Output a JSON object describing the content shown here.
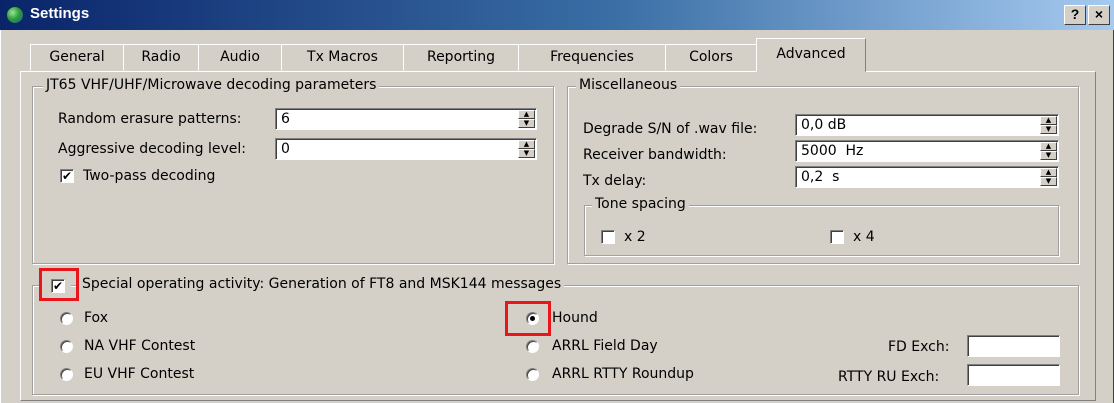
{
  "window": {
    "title": "Settings",
    "help_label": "?",
    "close_label": "×"
  },
  "tabs": [
    {
      "label": "General"
    },
    {
      "label": "Radio"
    },
    {
      "label": "Audio"
    },
    {
      "label": "Tx Macros"
    },
    {
      "label": "Reporting"
    },
    {
      "label": "Frequencies"
    },
    {
      "label": "Colors"
    },
    {
      "label": "Advanced"
    }
  ],
  "active_tab": "Advanced",
  "jt65": {
    "title": "JT65 VHF/UHF/Microwave decoding parameters",
    "random_erasure_label": "Random erasure patterns:",
    "random_erasure_value": "6",
    "aggressive_label": "Aggressive decoding level:",
    "aggressive_value": "0",
    "two_pass_label": "Two-pass decoding",
    "two_pass_checked": true
  },
  "misc": {
    "title": "Miscellaneous",
    "degrade_label": "Degrade S/N of .wav file:",
    "degrade_value": "0,0 dB",
    "bandwidth_label": "Receiver bandwidth:",
    "bandwidth_value": "5000  Hz",
    "txdelay_label": "Tx delay:",
    "txdelay_value": "0,2  s",
    "tone_spacing": {
      "title": "Tone spacing",
      "x2_label": "x 2",
      "x2_checked": false,
      "x4_label": "x 4",
      "x4_checked": false
    }
  },
  "special": {
    "title": "Special operating activity:  Generation of FT8 and MSK144 messages",
    "enabled": true,
    "options_left": [
      "Fox",
      "NA VHF Contest",
      "EU VHF Contest"
    ],
    "options_right": [
      "Hound",
      "ARRL Field Day",
      "ARRL RTTY Roundup"
    ],
    "selected": "Hound",
    "fd_exch_label": "FD Exch:",
    "fd_exch_value": "",
    "rtty_exch_label": "RTTY RU Exch:",
    "rtty_exch_value": ""
  },
  "icons": {
    "app": "app-globe-icon",
    "check": "✔"
  },
  "colors": {
    "highlight": "#e8151b",
    "titlebar": "#0a246a",
    "face": "#d4d0c8"
  }
}
